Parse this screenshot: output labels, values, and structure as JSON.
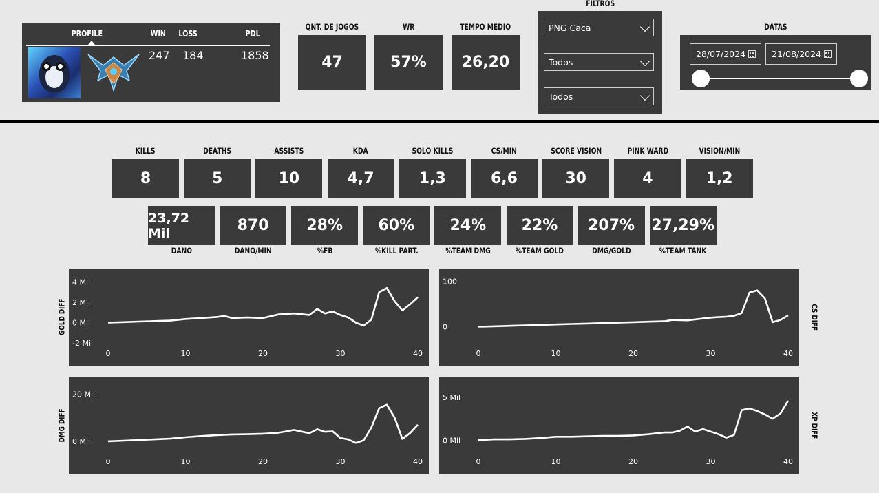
{
  "profile": {
    "headers": {
      "profile": "PROFILE",
      "win": "WIN",
      "loss": "LOSS",
      "pdl": "PDL"
    },
    "win": "247",
    "loss": "184",
    "pdl": "1858",
    "avatar_icon": "penguin-avatar-icon",
    "rank_icon": "rank-emblem-icon"
  },
  "summary": [
    {
      "label": "QNT. DE JOGOS",
      "value": "47"
    },
    {
      "label": "WR",
      "value": "57%"
    },
    {
      "label": "TEMPO MÉDIO",
      "value": "26,20"
    }
  ],
  "filters": {
    "title": "FILTROS",
    "selects": [
      "PNG Caca",
      "Todos",
      "Todos"
    ]
  },
  "dates": {
    "title": "DATAS",
    "start": "28/07/2024",
    "end": "21/08/2024"
  },
  "stats_row1": [
    {
      "label": "KILLS",
      "value": "8"
    },
    {
      "label": "DEATHS",
      "value": "5"
    },
    {
      "label": "ASSISTS",
      "value": "10"
    },
    {
      "label": "KDA",
      "value": "4,7"
    },
    {
      "label": "SOLO KILLS",
      "value": "1,3"
    },
    {
      "label": "CS/MIN",
      "value": "6,6"
    },
    {
      "label": "SCORE VISION",
      "value": "30"
    },
    {
      "label": "PINK WARD",
      "value": "4"
    },
    {
      "label": "VISION/MIN",
      "value": "1,2"
    }
  ],
  "stats_row2": [
    {
      "label": "DANO",
      "value": "23,72 Mil"
    },
    {
      "label": "DANO/MIN",
      "value": "870"
    },
    {
      "label": "%FB",
      "value": "28%"
    },
    {
      "label": "%KILL PART.",
      "value": "60%"
    },
    {
      "label": "%TEAM DMG",
      "value": "24%"
    },
    {
      "label": "%TEAM GOLD",
      "value": "22%"
    },
    {
      "label": "DMG/GOLD",
      "value": "207%"
    },
    {
      "label": "%TEAM TANK",
      "value": "27,29%"
    }
  ],
  "chart_data": [
    {
      "type": "line",
      "ylabel": "GOLD DIFF",
      "xticks": [
        "0",
        "10",
        "20",
        "30",
        "40"
      ],
      "yticks": [
        {
          "v": -2000,
          "t": "-2 Mil"
        },
        {
          "v": 0,
          "t": "0 Mil"
        },
        {
          "v": 2000,
          "t": "2 Mil"
        },
        {
          "v": 4000,
          "t": "4 Mil"
        }
      ],
      "ylim": [
        -2200,
        4300
      ],
      "x": [
        0,
        2,
        4,
        6,
        8,
        10,
        12,
        14,
        15,
        16,
        18,
        20,
        22,
        24,
        26,
        27,
        28,
        29,
        30,
        31,
        32,
        33,
        34,
        35,
        36,
        37,
        38,
        39,
        40
      ],
      "y": [
        0,
        50,
        100,
        150,
        200,
        350,
        450,
        550,
        650,
        450,
        500,
        450,
        800,
        900,
        750,
        1350,
        900,
        1100,
        750,
        500,
        0,
        -300,
        300,
        3000,
        3400,
        2100,
        1200,
        1800,
        2500
      ]
    },
    {
      "type": "line",
      "ylabel": "CS DIFF",
      "xticks": [
        "0",
        "10",
        "20",
        "30",
        "40"
      ],
      "yticks": [
        {
          "v": 0,
          "t": "0"
        },
        {
          "v": 100,
          "t": "100"
        }
      ],
      "ylim": [
        -40,
        105
      ],
      "x": [
        0,
        2,
        4,
        6,
        8,
        10,
        12,
        14,
        16,
        18,
        20,
        22,
        24,
        25,
        27,
        29,
        30,
        31,
        32,
        33,
        34,
        35,
        36,
        37,
        38,
        39,
        40
      ],
      "y": [
        0,
        1,
        2,
        3,
        4,
        5,
        6,
        7,
        8,
        9,
        10,
        11,
        12,
        15,
        14,
        18,
        20,
        21,
        22,
        24,
        30,
        75,
        80,
        62,
        10,
        15,
        25
      ]
    },
    {
      "type": "line",
      "ylabel": "DMG DIFF",
      "xticks": [
        "0",
        "10",
        "20",
        "30",
        "40"
      ],
      "yticks": [
        {
          "v": 0,
          "t": "0 Mil"
        },
        {
          "v": 20000,
          "t": "20 Mil"
        }
      ],
      "ylim": [
        -5000,
        23000
      ],
      "x": [
        0,
        2,
        4,
        6,
        8,
        10,
        12,
        14,
        16,
        18,
        20,
        22,
        23,
        24,
        26,
        27,
        28,
        29,
        30,
        31,
        32,
        33,
        34,
        35,
        36,
        37,
        38,
        39,
        40
      ],
      "y": [
        0,
        250,
        500,
        800,
        1100,
        1700,
        2200,
        2600,
        2900,
        3000,
        3200,
        3600,
        4200,
        4800,
        3400,
        5100,
        4000,
        4200,
        1400,
        800,
        -700,
        400,
        5800,
        14000,
        15500,
        10000,
        1000,
        3500,
        7000
      ]
    },
    {
      "type": "line",
      "ylabel": "XP DIFF",
      "xticks": [
        "0",
        "10",
        "20",
        "30",
        "40"
      ],
      "yticks": [
        {
          "v": 0,
          "t": "0 Mil"
        },
        {
          "v": 5000,
          "t": "5 Mil"
        }
      ],
      "ylim": [
        -1500,
        6200
      ],
      "x": [
        0,
        2,
        4,
        6,
        8,
        10,
        12,
        14,
        16,
        18,
        20,
        22,
        24,
        25,
        26,
        27,
        28,
        29,
        30,
        31,
        32,
        33,
        34,
        35,
        36,
        37,
        38,
        39,
        40
      ],
      "y": [
        0,
        100,
        100,
        150,
        250,
        400,
        400,
        450,
        500,
        500,
        550,
        700,
        900,
        900,
        1100,
        1600,
        1000,
        1300,
        1000,
        700,
        300,
        600,
        3500,
        3700,
        3400,
        3000,
        2500,
        3100,
        4600
      ]
    }
  ]
}
